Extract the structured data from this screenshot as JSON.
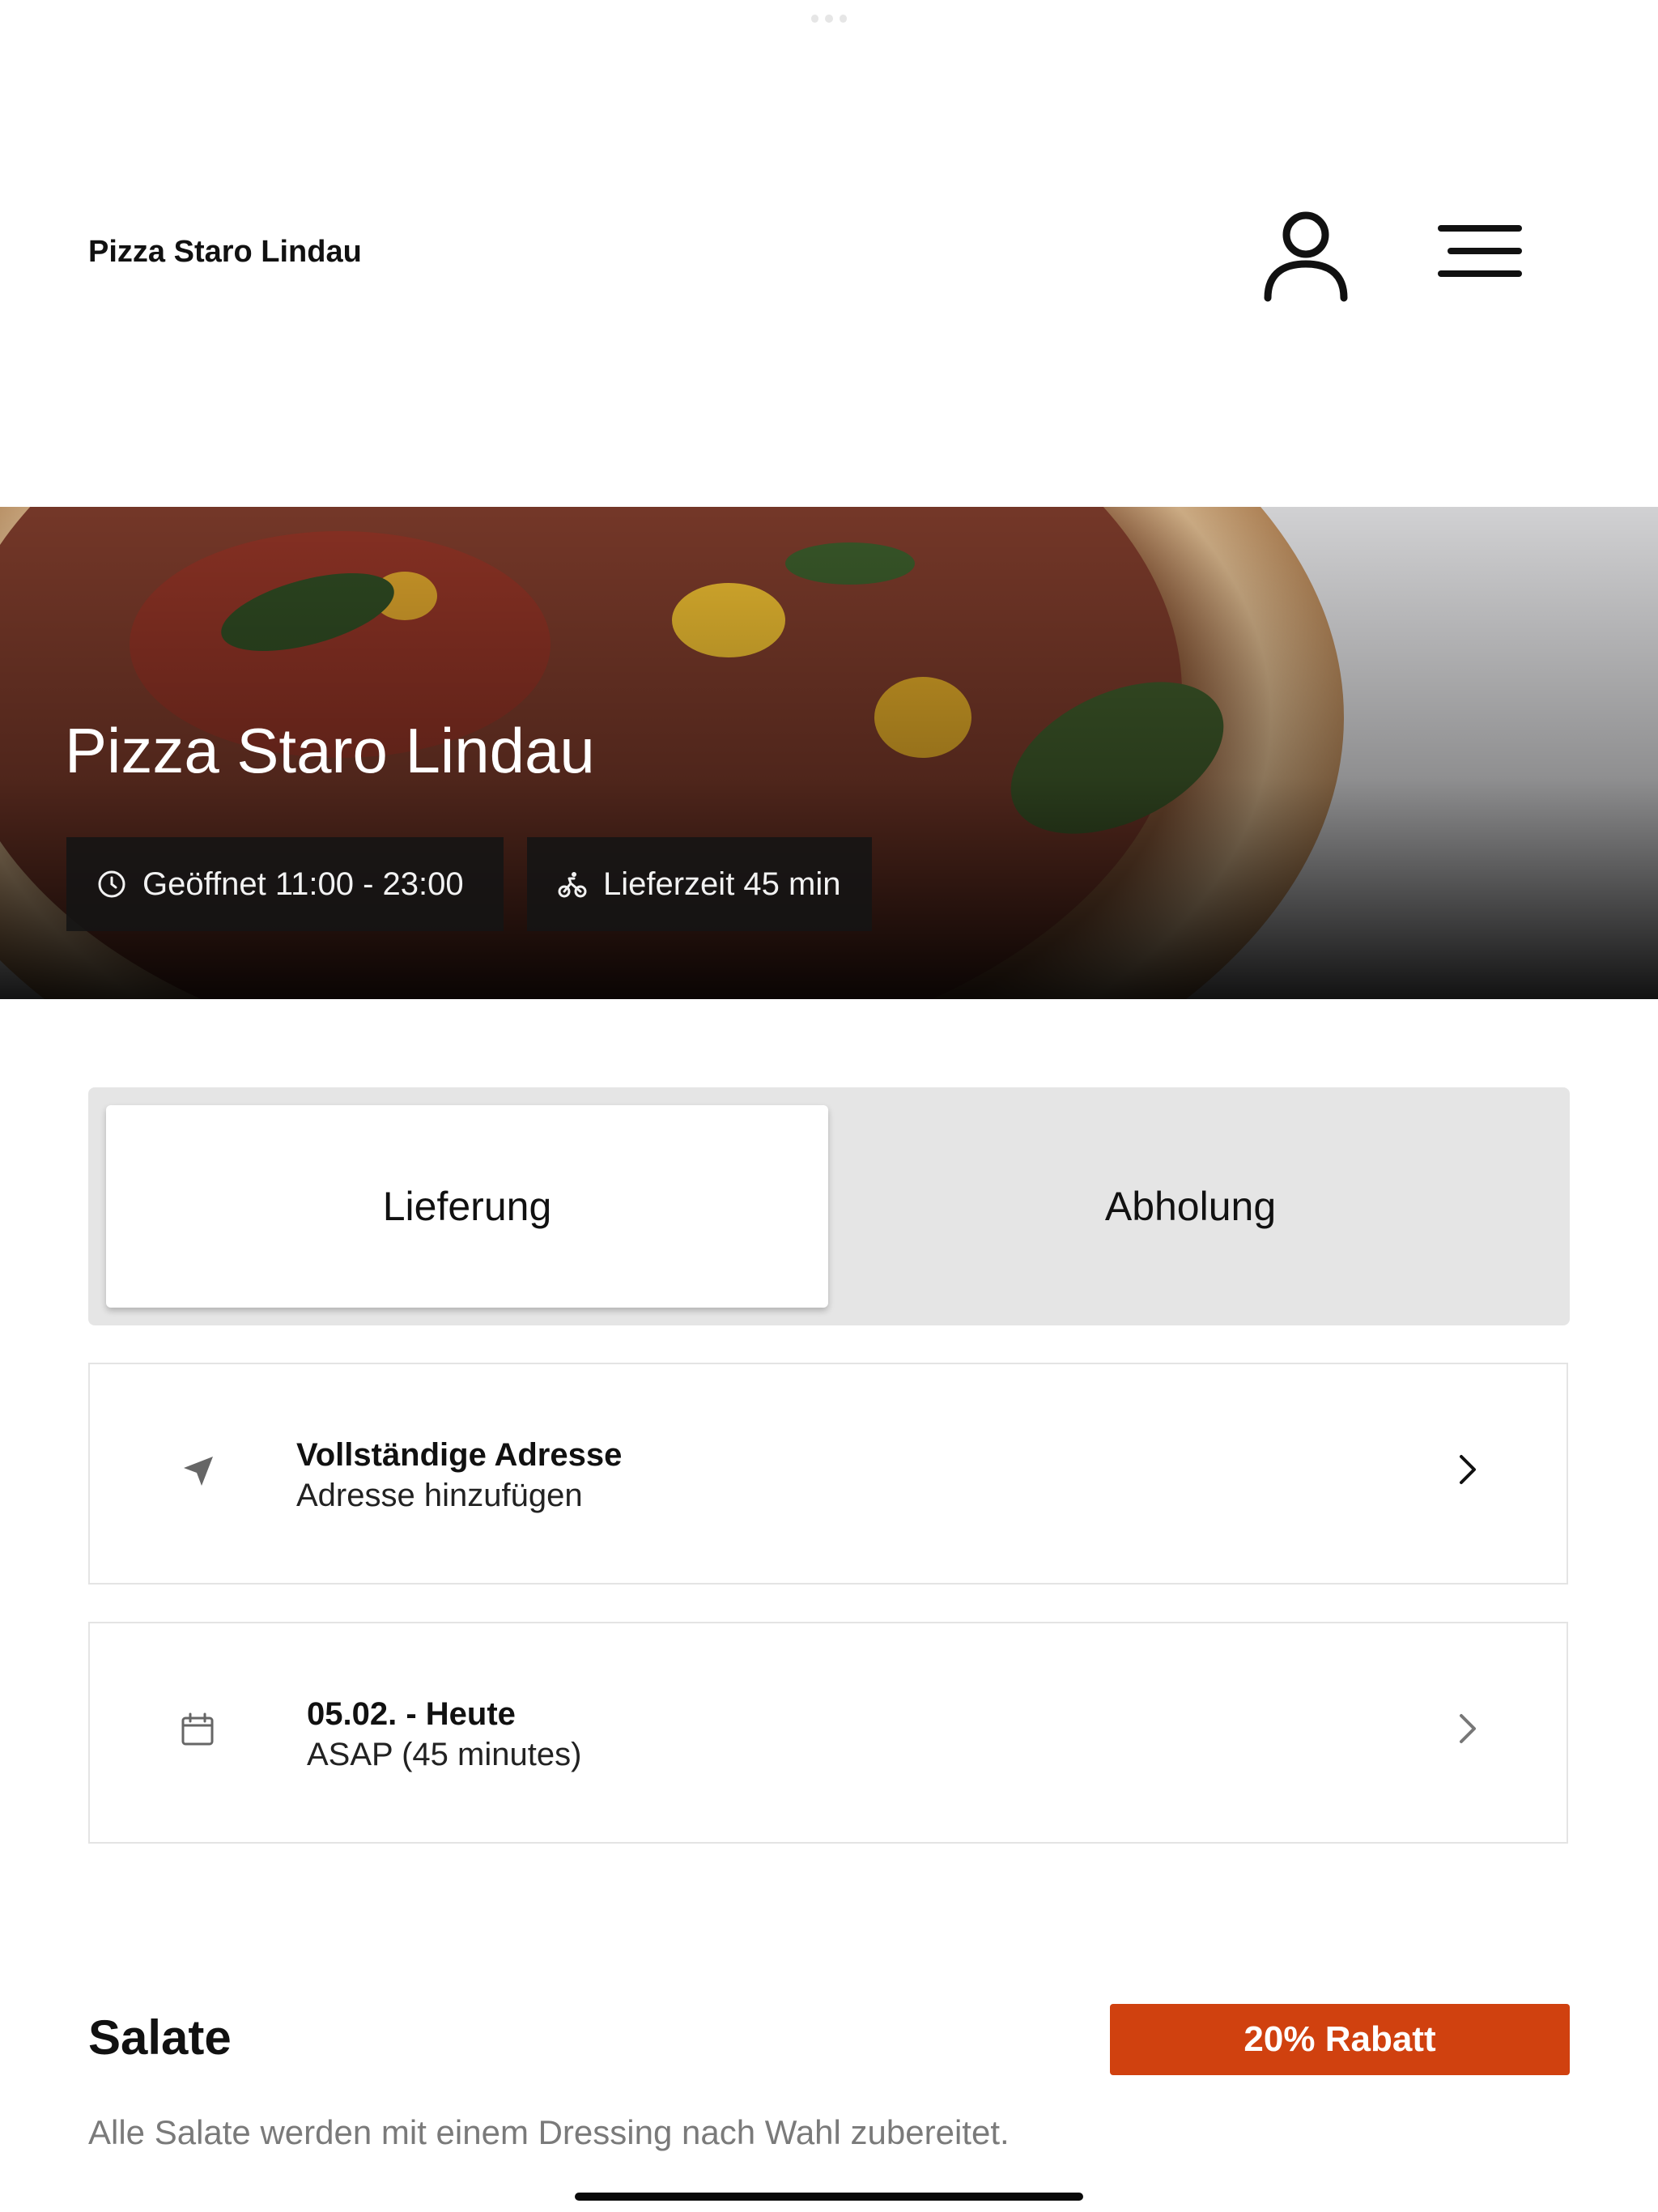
{
  "header": {
    "title": "Pizza Staro Lindau",
    "icons": {
      "user": "user-icon",
      "menu": "menu-icon"
    }
  },
  "hero": {
    "title": "Pizza Staro Lindau",
    "hours_label": "Geöffnet 11:00 - 23:00",
    "delivery_label": "Lieferzeit 45 min",
    "icons": {
      "hours": "clock-icon",
      "delivery": "bicycle-icon"
    }
  },
  "order_mode": {
    "options": [
      "Lieferung",
      "Abholung"
    ],
    "selected": "Lieferung"
  },
  "address_card": {
    "title": "Vollständige Adresse",
    "subtitle": "Adresse hinzufügen",
    "icon": "location-arrow-icon"
  },
  "time_card": {
    "title": "05.02. - Heute",
    "subtitle": "ASAP (45 minutes)",
    "icon": "calendar-icon"
  },
  "section": {
    "title": "Salate",
    "badge": "20% Rabatt",
    "description": "Alle Salate werden mit einem Dressing nach Wahl zubereitet."
  },
  "colors": {
    "accent": "#d0410f",
    "segment_bg": "#e5e5e5",
    "card_border": "#e4e4e4"
  }
}
